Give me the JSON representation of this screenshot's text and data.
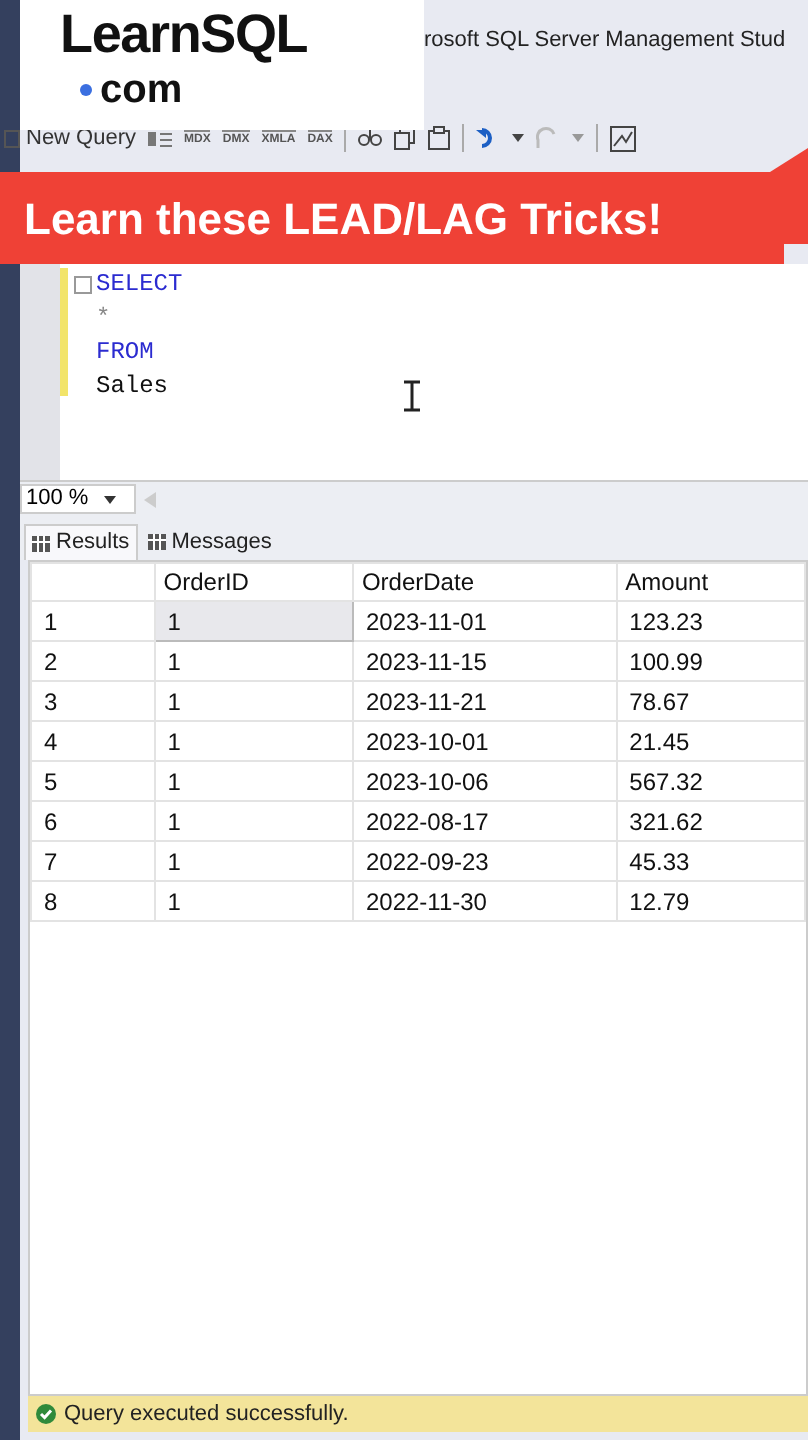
{
  "logo": {
    "name": "LearnSQL",
    "suffix": "com"
  },
  "window": {
    "title": "rosoft SQL Server Management Stud"
  },
  "toolbar": {
    "new_query": "New Query",
    "icon_labels": [
      "MDX",
      "DMX",
      "XMLA",
      "DAX"
    ]
  },
  "banner": {
    "text": "Learn these LEAD/LAG Tricks!"
  },
  "editor": {
    "lines": [
      {
        "text": "SELECT",
        "kind": "keyword"
      },
      {
        "text": "*",
        "kind": "operator"
      },
      {
        "text": "FROM",
        "kind": "keyword"
      },
      {
        "text": "Sales",
        "kind": "identifier"
      }
    ]
  },
  "zoom": {
    "value": "100 %"
  },
  "tabs": [
    {
      "label": "Results",
      "selected": true
    },
    {
      "label": "Messages",
      "selected": false
    }
  ],
  "table": {
    "columns": [
      "OrderID",
      "OrderDate",
      "Amount"
    ],
    "rows": [
      {
        "number": "1",
        "cells": [
          "1",
          "2023-11-01",
          "123.23"
        ],
        "selected": true
      },
      {
        "number": "2",
        "cells": [
          "1",
          "2023-11-15",
          "100.99"
        ],
        "selected": false
      },
      {
        "number": "3",
        "cells": [
          "1",
          "2023-11-21",
          "78.67"
        ],
        "selected": false
      },
      {
        "number": "4",
        "cells": [
          "1",
          "2023-10-01",
          "21.45"
        ],
        "selected": false
      },
      {
        "number": "5",
        "cells": [
          "1",
          "2023-10-06",
          "567.32"
        ],
        "selected": false
      },
      {
        "number": "6",
        "cells": [
          "1",
          "2022-08-17",
          "321.62"
        ],
        "selected": false
      },
      {
        "number": "7",
        "cells": [
          "1",
          "2022-09-23",
          "45.33"
        ],
        "selected": false
      },
      {
        "number": "8",
        "cells": [
          "1",
          "2022-11-30",
          "12.79"
        ],
        "selected": false
      }
    ]
  },
  "status_bar": {
    "text": "Query executed successfully."
  }
}
